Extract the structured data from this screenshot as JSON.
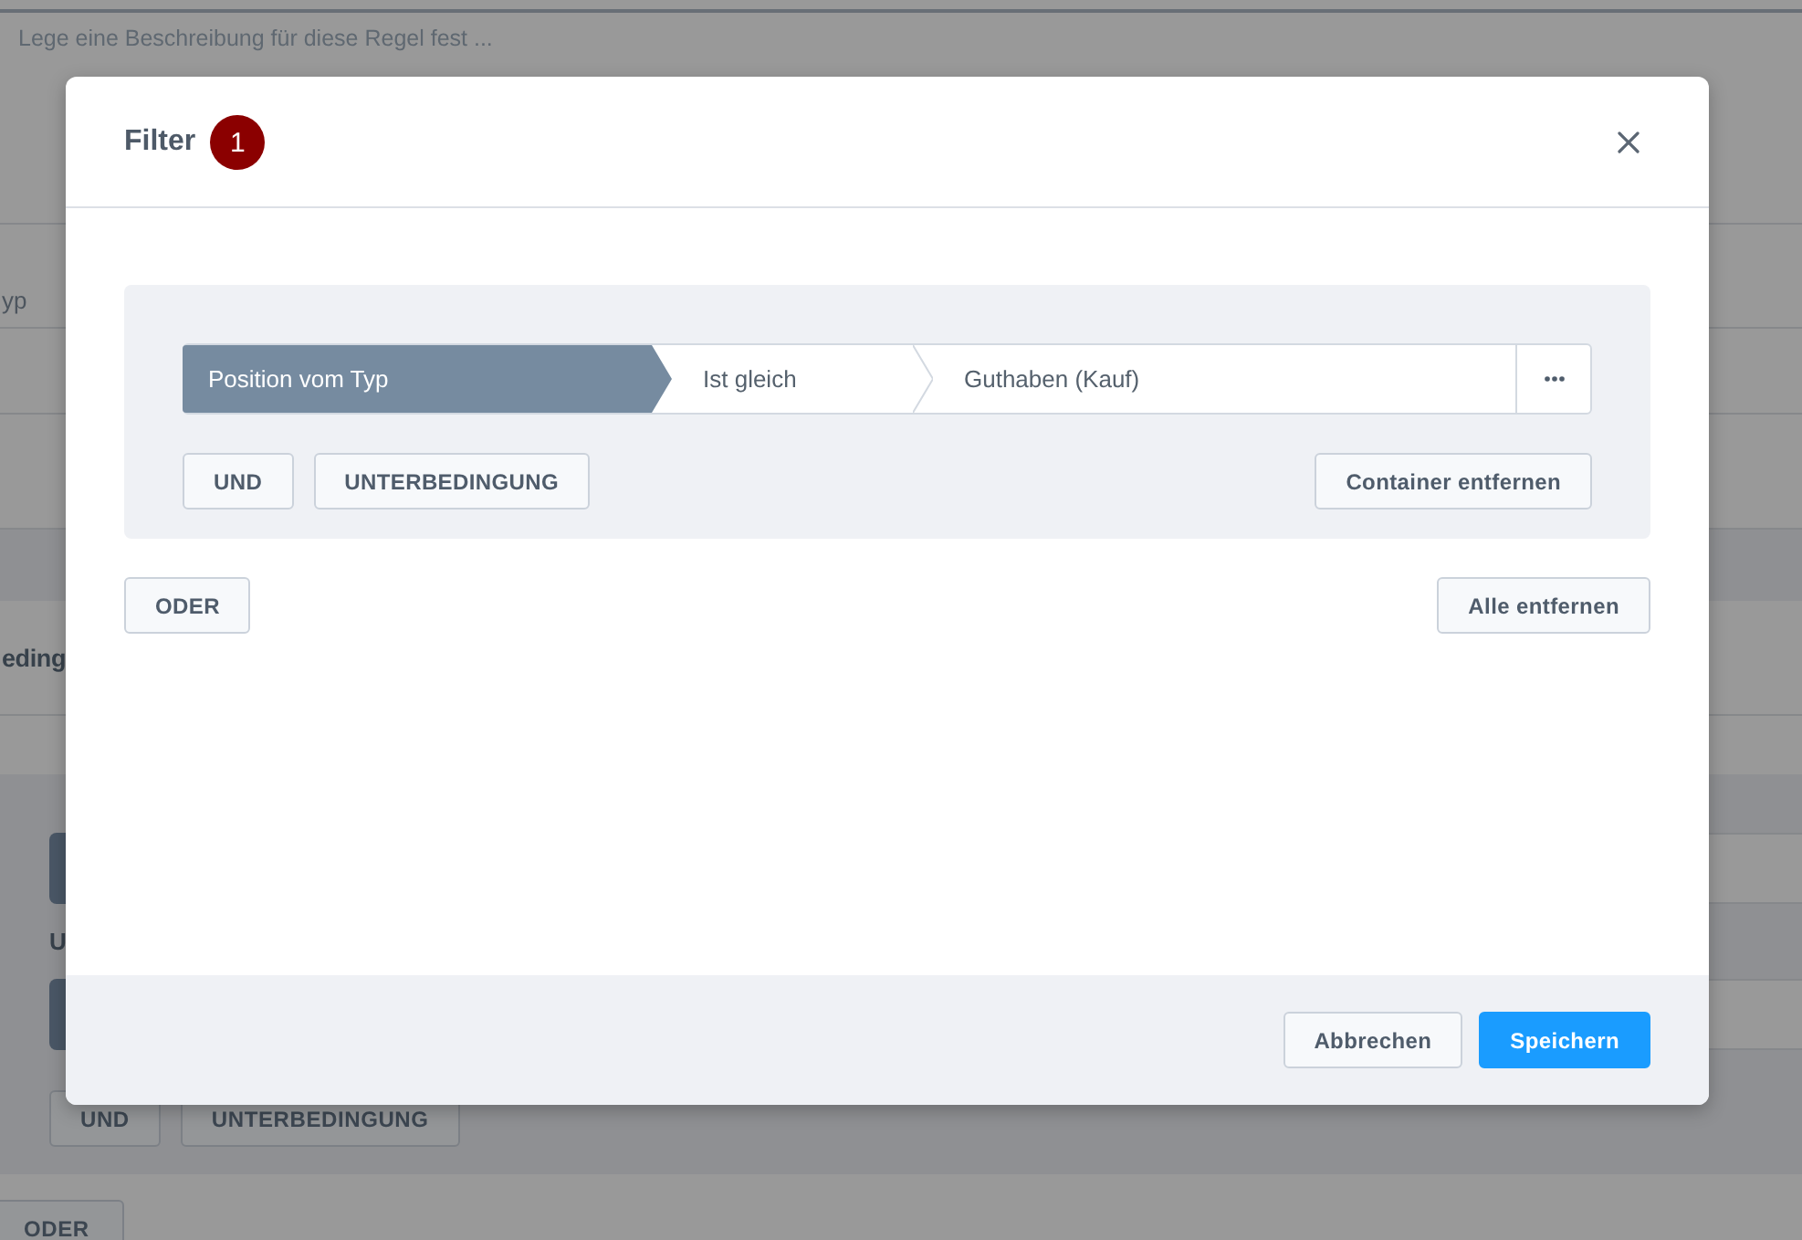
{
  "page": {
    "description_placeholder": "Lege eine Beschreibung für diese Regel fest ...",
    "column_label": "yp",
    "section_heading": "eding",
    "connector_label": "U",
    "buttons": [
      "UND",
      "UNTERBEDINGUNG"
    ],
    "or_button": "ODER"
  },
  "dialog": {
    "title": "Filter",
    "badge": "1",
    "group": {
      "conditions": [
        {
          "field": "Position vom Typ",
          "operator": "Ist gleich",
          "value": "Guthaben (Kauf)"
        }
      ],
      "buttons": [
        "UND",
        "UNTERBEDINGUNG"
      ],
      "remove_button": "Container entfernen"
    },
    "or_button": "ODER",
    "remove_all_button": "Alle entfernen",
    "footer_buttons": [
      {
        "label": "Abbrechen",
        "kind": "secondary"
      },
      {
        "label": "Speichern",
        "kind": "primary"
      }
    ]
  }
}
